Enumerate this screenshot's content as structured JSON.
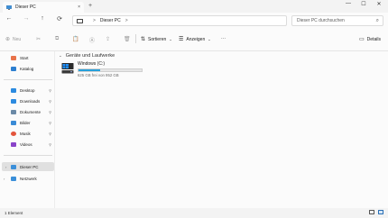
{
  "window": {
    "tab_title": "Dieser PC",
    "tab_close": "×",
    "new_tab": "+",
    "minimize": "—",
    "maximize": "☐",
    "close": "✕"
  },
  "navigation": {
    "back": "←",
    "forward": "→",
    "up": "↑",
    "refresh": "⟳",
    "address_separator_1": ">",
    "address_location": "Dieser PC",
    "address_separator_2": ">",
    "search_placeholder": "Dieser PC durchsuchen"
  },
  "commandbar": {
    "new_label": "Neu",
    "sort_label": "Sortieren",
    "view_label": "Anzeigen",
    "more_label": "···",
    "details_label": "Details"
  },
  "sidebar": {
    "items": [
      {
        "label": "Start",
        "icon": "home-icon",
        "color": "#e8734a",
        "pinned": false
      },
      {
        "label": "Katalog",
        "icon": "gallery-icon",
        "color": "#2d7fd0",
        "pinned": false
      },
      {
        "label": "Desktop",
        "icon": "desktop-folder-icon",
        "color": "#2c8be0",
        "pinned": true
      },
      {
        "label": "Downloads",
        "icon": "download-icon",
        "color": "#2c8be0",
        "pinned": true
      },
      {
        "label": "Dokumente",
        "icon": "documents-icon",
        "color": "#6b8aa7",
        "pinned": true
      },
      {
        "label": "Bilder",
        "icon": "pictures-icon",
        "color": "#3a8bd6",
        "pinned": true
      },
      {
        "label": "Musik",
        "icon": "music-icon",
        "color": "#e3543c",
        "pinned": true
      },
      {
        "label": "Videos",
        "icon": "videos-icon",
        "color": "#8a44c9",
        "pinned": true
      },
      {
        "label": "Dieser PC",
        "icon": "this-pc-icon",
        "color": "#3b8fd9",
        "selected": true
      },
      {
        "label": "Netzwerk",
        "icon": "network-icon",
        "color": "#3b8fd9"
      }
    ],
    "pin_glyph": "📌"
  },
  "main": {
    "group_title": "Geräte und Laufwerke",
    "drives": [
      {
        "name": "Windows (C:)",
        "free_text": "625 GB frei von 952 GB",
        "used_fraction": 0.34
      }
    ]
  },
  "status": {
    "count": "1 Element"
  },
  "colors": {
    "accent": "#26a0da",
    "selection": "#e0e0e0"
  }
}
